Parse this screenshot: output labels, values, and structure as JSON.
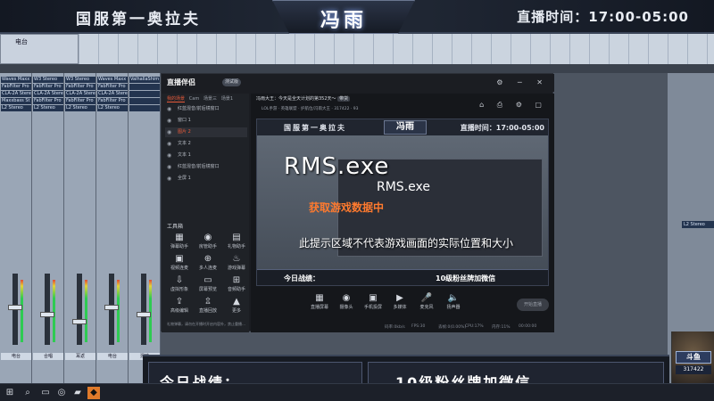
{
  "banner": {
    "left_title": "国服第一奥拉夫",
    "center_name": "冯雨",
    "right_time": "直播时间：17:00-05:00"
  },
  "daw": {
    "track_label": "电台",
    "strips": [
      {
        "slots": [
          "Waves Maxx",
          "FabFilter Pro",
          "CLA-2A Stere",
          "Maxxbass St",
          "L2 Stereo"
        ],
        "name": "电台"
      },
      {
        "slots": [
          "W3 Stereo",
          "FabFilter Pro",
          "CLA-2A Stere",
          "FabFilter Pro",
          "L2 Stereo"
        ],
        "name": "合唱"
      },
      {
        "slots": [
          "W3 Stereo",
          "FabFilter Pro",
          "CLA-2A Stere",
          "FabFilter Pro",
          "L2 Stereo"
        ],
        "name": "耳返"
      },
      {
        "slots": [
          "Waves Maxx",
          "FabFilter Pro",
          "CLA-2A Stere",
          "FabFilter Pro",
          "L2 Stereo"
        ],
        "name": "电台"
      },
      {
        "slots": [
          "ValhallaShim",
          "",
          "",
          "",
          ""
        ],
        "name": "混响"
      }
    ],
    "right_slot": "L2 Stereo"
  },
  "app": {
    "logo": "直播伴侣",
    "version": "测试版",
    "scene_tabs": [
      "我的场景",
      "Cam",
      "场景三",
      "场景1"
    ],
    "scenes": [
      {
        "label": "红蓝混音/前后镜窗口",
        "active": false
      },
      {
        "label": "窗口 1",
        "active": false
      },
      {
        "label": "图片 2",
        "active": true
      },
      {
        "label": "文本 2",
        "active": false
      },
      {
        "label": "文本 1",
        "active": false
      },
      {
        "label": "红蓝混音/前后镜窗口",
        "active": false
      },
      {
        "label": "全屏 1",
        "active": false
      }
    ],
    "tools_title": "工具箱",
    "tools": [
      {
        "icon": "▦",
        "label": "弹幕助手"
      },
      {
        "icon": "◉",
        "label": "房管助手"
      },
      {
        "icon": "▤",
        "label": "礼物助手"
      },
      {
        "icon": "▣",
        "label": "视频连麦"
      },
      {
        "icon": "⊕",
        "label": "多人连麦"
      },
      {
        "icon": "♨",
        "label": "游戏弹幕"
      },
      {
        "icon": "⇩",
        "label": "虚拟形象"
      },
      {
        "icon": "▭",
        "label": "屏幕预览"
      },
      {
        "icon": "⊞",
        "label": "音频助手"
      },
      {
        "icon": "⇪",
        "label": "高级编辑"
      },
      {
        "icon": "⇫",
        "label": "直播回放"
      },
      {
        "icon": "▲",
        "label": "更多"
      }
    ],
    "tip": "礼物弹幕，请勿在开播时开启内容外，禁止重播…",
    "room_title": "冯雨大王：今天是全天计划的第352天～",
    "room_tag": "带货",
    "room_sub": "LOL手游 · 英雄联盟 · 护航位/冯雨大王 · 317422 · 93",
    "preview": {
      "top_left": "国服第一奥拉夫",
      "top_center": "冯雨",
      "top_right": "直播时间：17:00-05:00",
      "rms_big": "RMS.exe",
      "rms_small": "RMS.exe",
      "capture_text": "获取游戏数据中",
      "warning": "此提示区域不代表游戏画面的实际位置和大小",
      "bottom_left": "今日战绩：",
      "bottom_right": "10级粉丝牌加微信"
    },
    "bottom_tools": [
      {
        "icon": "▦",
        "label": "直播屏幕"
      },
      {
        "icon": "◉",
        "label": "摄像头"
      },
      {
        "icon": "▣",
        "label": "手机投屏"
      },
      {
        "icon": "▶",
        "label": "多媒体"
      },
      {
        "icon": "🎤",
        "label": "麦克风"
      },
      {
        "icon": "🔈",
        "label": "扬声器"
      }
    ],
    "go_live": "开始直播",
    "status": [
      "码率:0kb/s",
      "FPS:30",
      "丢帧:0(0.00%)",
      "CPU:17%",
      "内存:11%",
      "00:00:00"
    ]
  },
  "bottom_overlay": {
    "left": "今日战绩：",
    "right": "10级粉丝牌加微信"
  },
  "mascot": {
    "logo": "斗鱼",
    "room_id": "317422"
  },
  "taskbar": {
    "icons": [
      "windows-icon",
      "search-icon",
      "task-view-icon",
      "chrome-icon",
      "folder-icon",
      "app-icon"
    ]
  }
}
